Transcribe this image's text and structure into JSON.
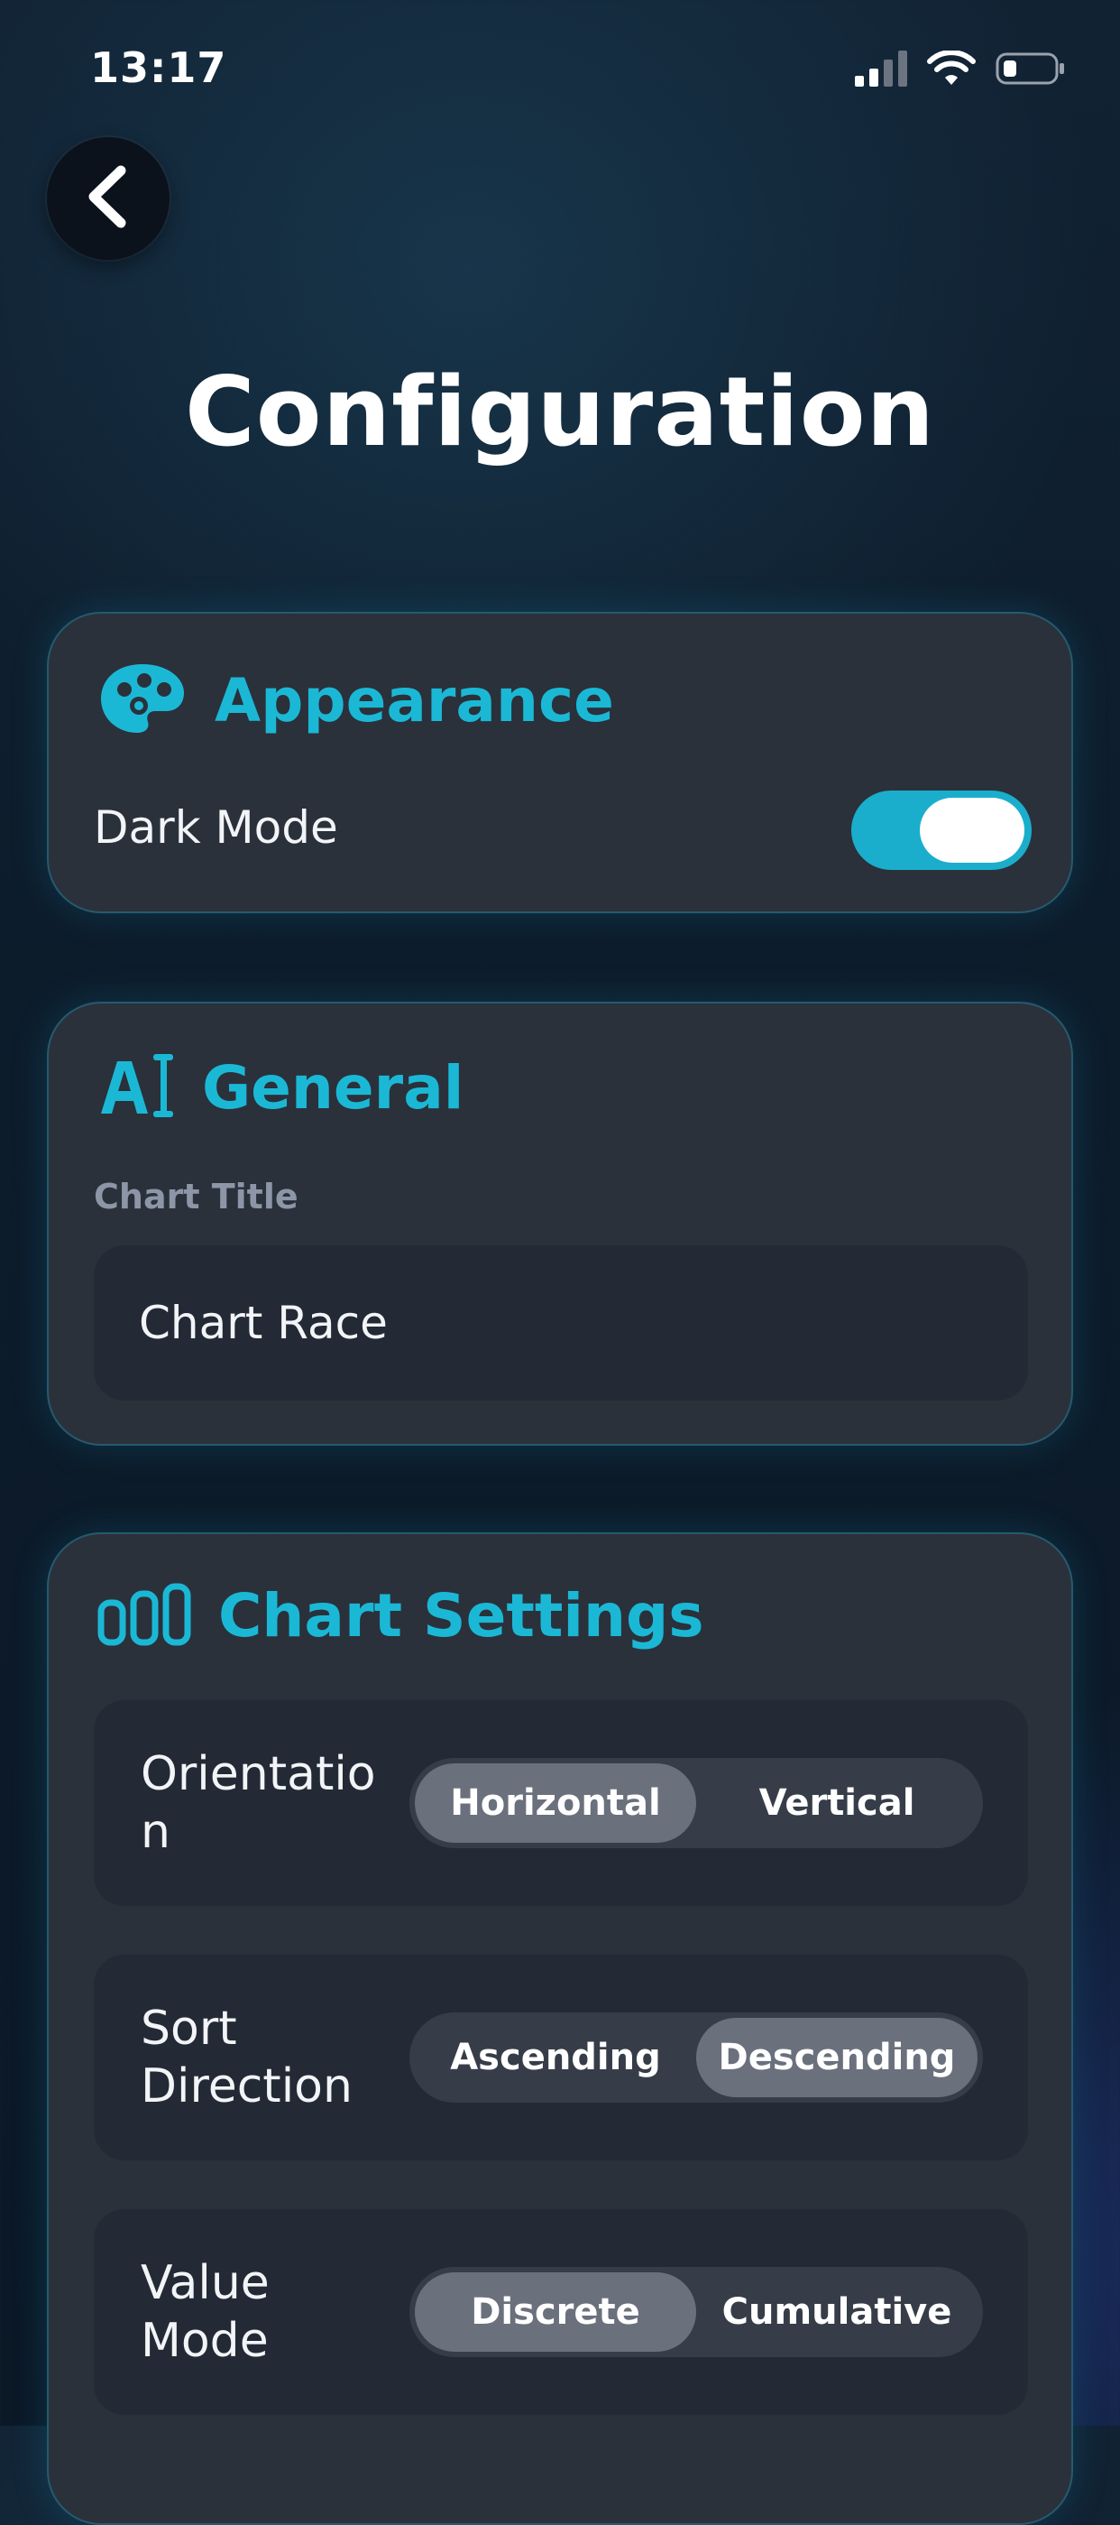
{
  "status_bar": {
    "time": "13:17"
  },
  "page": {
    "title": "Configuration"
  },
  "appearance": {
    "title": "Appearance",
    "dark_mode_label": "Dark Mode",
    "dark_mode_on": true
  },
  "general": {
    "title": "General",
    "chart_title_label": "Chart Title",
    "chart_title_value": "Chart Race"
  },
  "chart_settings": {
    "title": "Chart Settings",
    "orientation": {
      "label": "Orientation",
      "options": [
        "Horizontal",
        "Vertical"
      ],
      "selected": "Horizontal"
    },
    "sort_direction": {
      "label": "Sort Direction",
      "options": [
        "Ascending",
        "Descending"
      ],
      "selected": "Descending"
    },
    "value_mode": {
      "label": "Value Mode",
      "options": [
        "Discrete",
        "Cumulative"
      ],
      "selected": "Discrete"
    }
  },
  "colors": {
    "accent": "#1bb8d6",
    "card_bg": "#2a313b",
    "row_bg": "#232a35",
    "segment_selected": "#6a707c"
  },
  "icons": {
    "back": "chevron-left-icon",
    "appearance": "palette-icon",
    "general": "text-cursor-icon",
    "chart_settings": "bar-chart-icon",
    "signal": "cellular-signal-icon",
    "wifi": "wifi-icon",
    "battery": "battery-icon"
  }
}
